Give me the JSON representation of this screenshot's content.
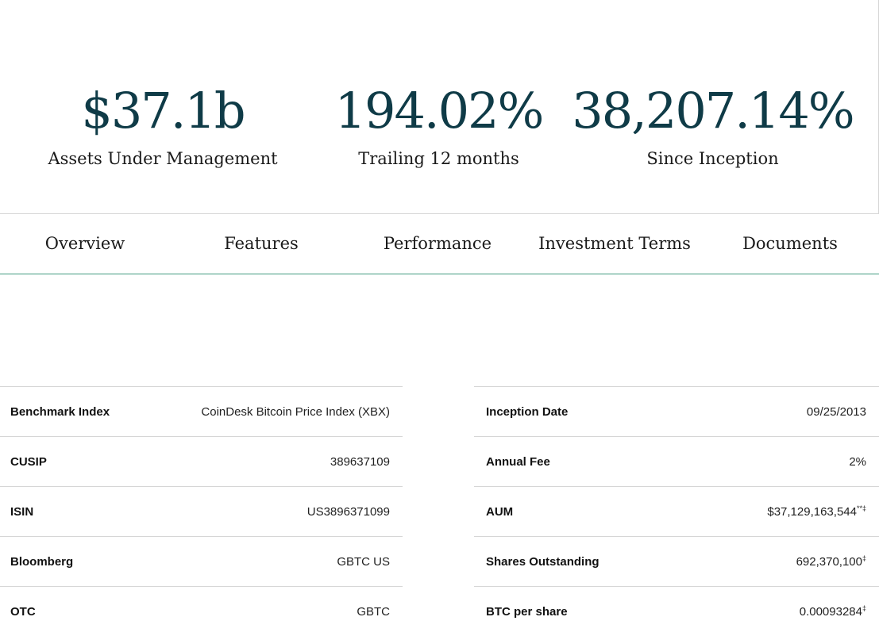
{
  "stats": [
    {
      "value": "$37.1b",
      "label": "Assets Under Management"
    },
    {
      "value": "194.02%",
      "label": "Trailing 12 months"
    },
    {
      "value": "38,207.14%",
      "label": "Since Inception"
    }
  ],
  "tabs": [
    "Overview",
    "Features",
    "Performance",
    "Investment Terms",
    "Documents"
  ],
  "left_terms": [
    {
      "key": "Benchmark Index",
      "value": "CoinDesk Bitcoin Price Index (XBX)",
      "mark": ""
    },
    {
      "key": "CUSIP",
      "value": "389637109",
      "mark": ""
    },
    {
      "key": "ISIN",
      "value": "US3896371099",
      "mark": ""
    },
    {
      "key": "Bloomberg",
      "value": "GBTC US",
      "mark": ""
    },
    {
      "key": "OTC",
      "value": "GBTC",
      "mark": ""
    }
  ],
  "right_terms": [
    {
      "key": "Inception Date",
      "value": "09/25/2013",
      "mark": ""
    },
    {
      "key": "Annual Fee",
      "value": "2%",
      "mark": ""
    },
    {
      "key": "AUM",
      "value": "$37,129,163,544",
      "mark": "**‡"
    },
    {
      "key": "Shares Outstanding",
      "value": "692,370,100",
      "mark": "‡"
    },
    {
      "key": "BTC per share",
      "value": "0.00093284",
      "mark": "‡"
    }
  ],
  "colors": {
    "accent": "#0f3b47",
    "tab_underline": "#3f9a7f",
    "divider": "#d6d6d6"
  }
}
